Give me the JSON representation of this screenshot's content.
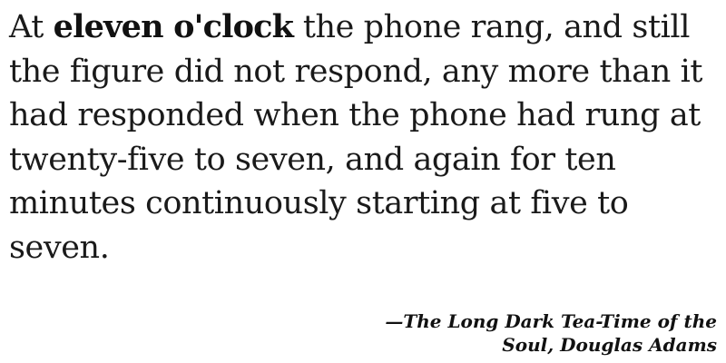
{
  "quote": {
    "lead": "At ",
    "emphasis": "eleven o'clock",
    "rest": " the phone rang, and still the figure did not respond, any more than it had responded when the phone had rung at twenty-five to seven, and again for ten minutes continuously starting at five to seven."
  },
  "attribution": {
    "text": "—The Long Dark Tea-Time of the Soul, Douglas Adams"
  }
}
